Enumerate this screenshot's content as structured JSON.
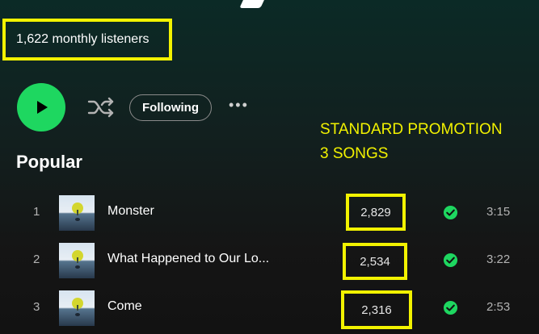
{
  "artist": {
    "monthly_listeners": "1,622 monthly listeners"
  },
  "actions": {
    "follow_label": "Following",
    "more_label": "•••"
  },
  "annotation": {
    "line1": "STANDARD PROMOTION",
    "line2": "3 SONGS",
    "color": "#f2f200"
  },
  "section_title": "Popular",
  "tracks": [
    {
      "rank": "1",
      "title": "Monster",
      "plays": "2,829",
      "duration": "3:15",
      "saved": true
    },
    {
      "rank": "2",
      "title": "What Happened to Our Lo...",
      "plays": "2,534",
      "duration": "3:22",
      "saved": true
    },
    {
      "rank": "3",
      "title": "Come",
      "plays": "2,316",
      "duration": "2:53",
      "saved": true
    }
  ],
  "colors": {
    "accent": "#1ed760",
    "highlight": "#f2f200"
  }
}
